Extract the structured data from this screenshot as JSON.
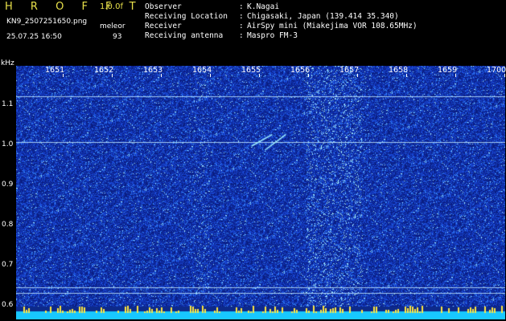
{
  "header": {
    "brand": "H R O F F T",
    "version": "1.0.0f",
    "filename": "KN9_2507251650.png",
    "timestamp": "25.07.25 16:50",
    "mode_label": "meleor",
    "count": "93"
  },
  "station_info": [
    {
      "label": "Observer",
      "value": "K.Nagai"
    },
    {
      "label": "Receiving Location",
      "value": "Chigasaki, Japan (139.414 35.340)"
    },
    {
      "label": "Receiver",
      "value": "AirSpy mini (Miakejima VOR 108.65MHz)"
    },
    {
      "label": "Receiving antenna",
      "value": "Maspro FM-3"
    }
  ],
  "separator": ":",
  "colors": {
    "background": "#000000",
    "brand": "#e8e04a",
    "spectrogram_base": "#0d2a8a",
    "spectrogram_noise": "#3a6cff",
    "signal": "#9ff0ff",
    "baseline_strip": "#18c8ff",
    "baseline_peaks": "#ffe640"
  },
  "chart_data": {
    "type": "heatmap",
    "title": "",
    "xlabel": "",
    "ylabel": "kHz",
    "x_ticks": [
      "1651",
      "1652",
      "1653",
      "1654",
      "1655",
      "1656",
      "1657",
      "1658",
      "1659",
      "1700"
    ],
    "y_ticks": [
      "1.1",
      "1.0",
      "0.9",
      "0.8",
      "0.7",
      "0.6"
    ],
    "ylim": [
      0.57,
      1.2
    ],
    "x_range": [
      "16:50",
      "17:00"
    ],
    "horizontal_lines_khz": [
      1.12,
      1.0,
      0.62,
      0.605
    ],
    "meteor_traces": [
      {
        "x_start": "1655",
        "x_end": "1655",
        "y_start": 0.99,
        "y_end": 1.02
      },
      {
        "x_start": "1655",
        "x_end": "1656",
        "y_start": 0.98,
        "y_end": 1.02
      }
    ],
    "grid": false,
    "legend": "none"
  }
}
